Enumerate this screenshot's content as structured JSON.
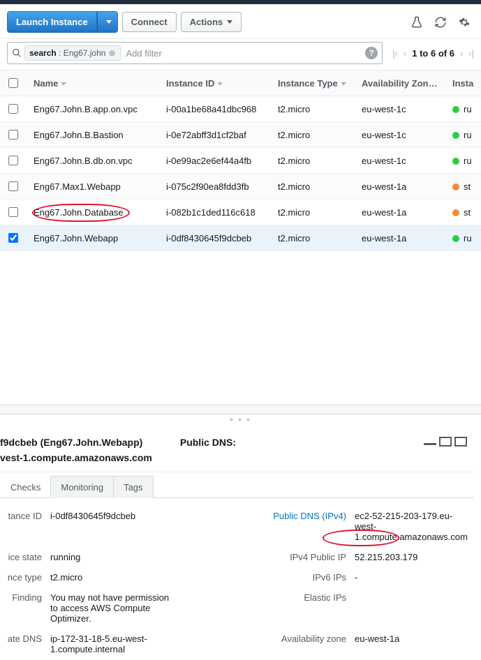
{
  "toolbar": {
    "launch_label": "Launch Instance",
    "connect_label": "Connect",
    "actions_label": "Actions"
  },
  "filter": {
    "search_key": "search",
    "search_value": "Eng67.john",
    "add_filter": "Add filter",
    "pager_text": "1 to 6 of 6"
  },
  "columns": {
    "name": "Name",
    "instance_id": "Instance ID",
    "instance_type": "Instance Type",
    "az": "Availability Zone",
    "state": "Insta"
  },
  "rows": [
    {
      "name": "Eng67.John.B.app.on.vpc",
      "id": "i-00a1be68a41dbc968",
      "type": "t2.micro",
      "az": "eu-west-1c",
      "dot": "green",
      "state": "ru",
      "selected": false
    },
    {
      "name": "Eng67.John.B.Bastion",
      "id": "i-0e72abff3d1cf2baf",
      "type": "t2.micro",
      "az": "eu-west-1c",
      "dot": "green",
      "state": "ru",
      "selected": false
    },
    {
      "name": "Eng67.John.B.db.on.vpc",
      "id": "i-0e99ac2e6ef44a4fb",
      "type": "t2.micro",
      "az": "eu-west-1c",
      "dot": "green",
      "state": "ru",
      "selected": false
    },
    {
      "name": "Eng67.Max1.Webapp",
      "id": "i-075c2f90ea8fdd3fb",
      "type": "t2.micro",
      "az": "eu-west-1a",
      "dot": "orange",
      "state": "st",
      "selected": false
    },
    {
      "name": "Eng67.John.Database",
      "id": "i-082b1c1ded116c618",
      "type": "t2.micro",
      "az": "eu-west-1a",
      "dot": "orange",
      "state": "st",
      "selected": false
    },
    {
      "name": "Eng67.John.Webapp",
      "id": "i-0df8430645f9dcbeb",
      "type": "t2.micro",
      "az": "eu-west-1a",
      "dot": "green",
      "state": "ru",
      "selected": true
    }
  ],
  "detail": {
    "heading_id_name": "f9dcbeb (Eng67.John.Webapp)",
    "heading_sub": "vest-1.compute.amazonaws.com",
    "public_dns_label": "Public DNS:",
    "tabs": {
      "checks": "Checks",
      "monitoring": "Monitoring",
      "tags": "Tags"
    },
    "kv": {
      "instance_id_k": "tance ID",
      "instance_id_v": "i-0df8430645f9dcbeb",
      "public_dns_k": "Public DNS (IPv4)",
      "public_dns_v": "ec2-52-215-203-179.eu-west-1.compute.amazonaws.com",
      "state_k": "ice state",
      "state_v": "running",
      "ipv4_k": "IPv4 Public IP",
      "ipv4_v": "52.215.203.179",
      "type_k": "nce type",
      "type_v": "t2.micro",
      "ipv6_k": "IPv6 IPs",
      "ipv6_v": "-",
      "finding_k": "Finding",
      "finding_v": "You may not have permission to access AWS Compute Optimizer.",
      "eip_k": "Elastic IPs",
      "eip_v": "",
      "pdns_k": "ate DNS",
      "pdns_v": "ip-172-31-18-5.eu-west-1.compute.internal",
      "az_k": "Availability zone",
      "az_v": "eu-west-1a"
    }
  }
}
